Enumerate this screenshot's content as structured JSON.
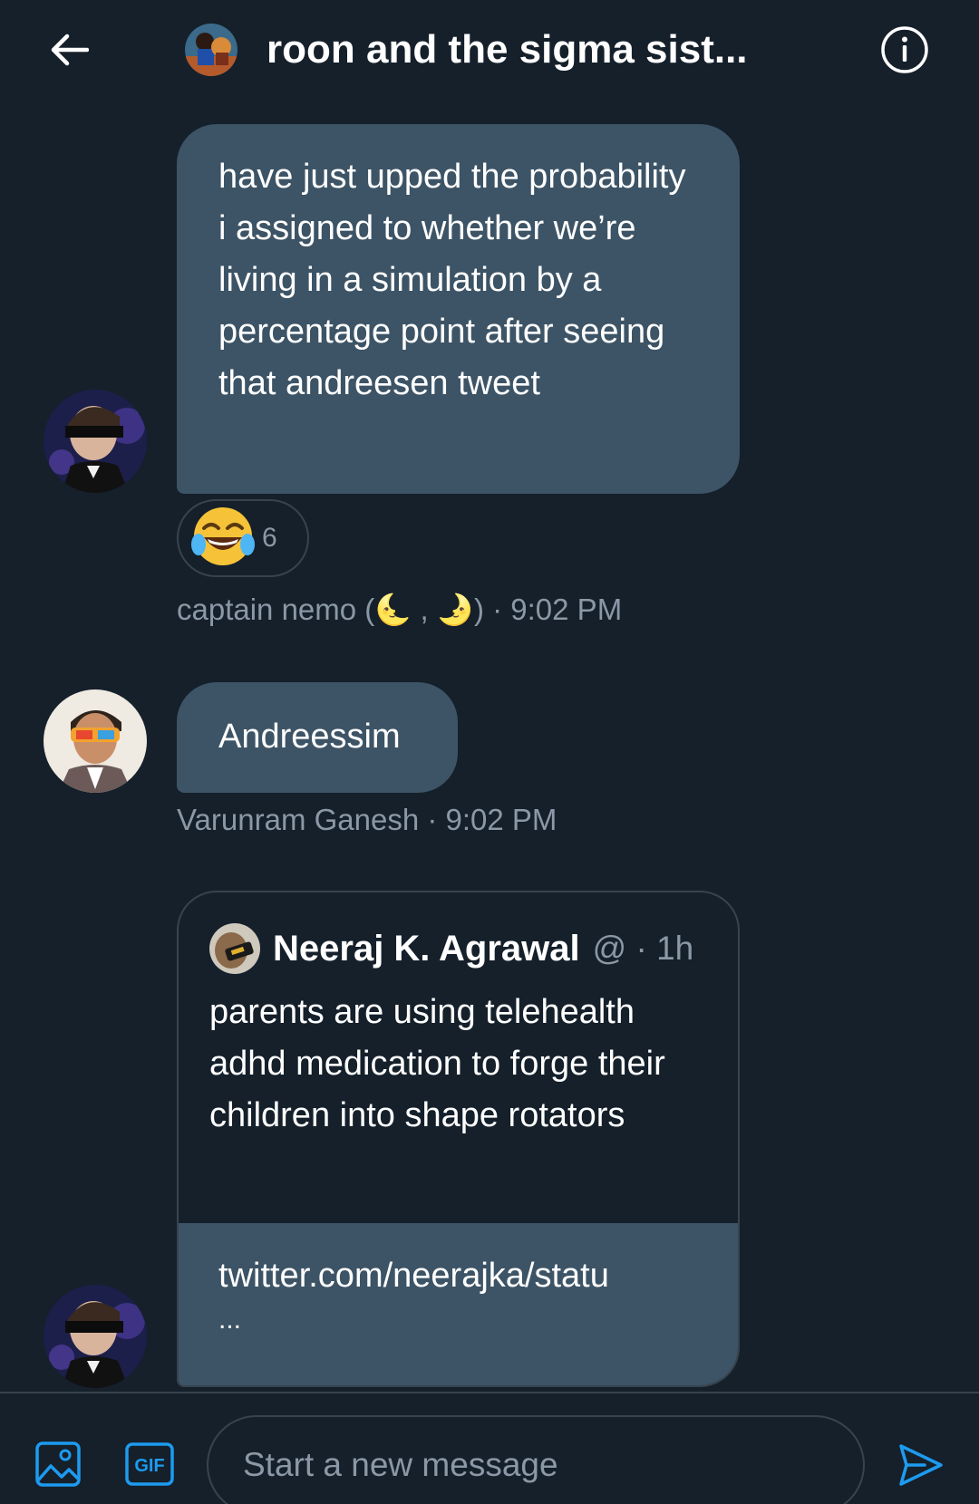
{
  "header": {
    "title": "roon and the sigma sist...",
    "back_icon": "arrow-left-icon",
    "info_icon": "info-icon"
  },
  "messages": [
    {
      "text": "have just upped the probability i assigned to whether we’re living in a simulation by a percentage point after seeing that andreesen tweet",
      "reaction": {
        "emoji": "😂",
        "count": "6"
      },
      "meta": "captain nemo (🌜 , 🌛) · 9:02 PM"
    },
    {
      "text": "Andreessim",
      "meta": "Varunram Ganesh · 9:02 PM"
    },
    {
      "tweet": {
        "name": "Neeraj K. Agrawal",
        "handle": "@ · 1h",
        "text": "parents are using telehealth adhd medication to forge their children into shape rotators",
        "link": "twitter.com/neerajka/statu",
        "link_more": "..."
      }
    }
  ],
  "composer": {
    "placeholder": "Start a new message",
    "media_icon": "image-icon",
    "gif_label": "GIF",
    "send_icon": "send-icon"
  },
  "colors": {
    "background": "#15202b",
    "bubble": "#3d5466",
    "border": "#38444d",
    "secondary_text": "#8b98a5",
    "accent": "#1d9bf0"
  }
}
